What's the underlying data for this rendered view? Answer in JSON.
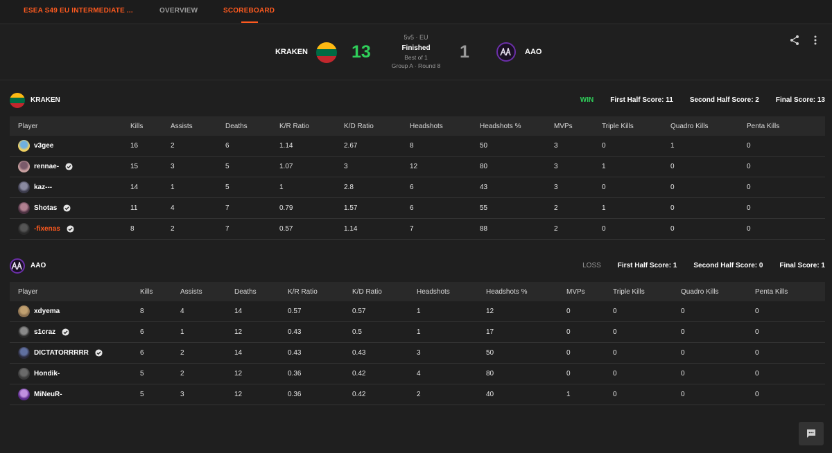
{
  "nav": {
    "event": "ESEA S49 EU INTERMEDIATE ...",
    "overview": "OVERVIEW",
    "scoreboard": "SCOREBOARD"
  },
  "match": {
    "team1": "KRAKEN",
    "team2": "AAO",
    "score1": "13",
    "score2": "1",
    "mode": "5v5 · EU",
    "status": "Finished",
    "format": "Best of 1",
    "round": "Group A · Round 8",
    "colors": {
      "win": "#2fcf5a",
      "accent": "#ff5a1f",
      "loss": "#9a9a9a"
    }
  },
  "columns": [
    "Player",
    "Kills",
    "Assists",
    "Deaths",
    "K/R Ratio",
    "K/D Ratio",
    "Headshots",
    "Headshots %",
    "MVPs",
    "Triple Kills",
    "Quadro Kills",
    "Penta Kills"
  ],
  "team1": {
    "name": "KRAKEN",
    "result": "WIN",
    "first_half": "First Half Score: 11",
    "second_half": "Second Half Score: 2",
    "final": "Final Score: 13",
    "players": [
      {
        "name": "v3gee",
        "verified": false,
        "highlight": false,
        "stats": [
          "16",
          "2",
          "6",
          "1.14",
          "2.67",
          "8",
          "50",
          "3",
          "0",
          "1",
          "0"
        ]
      },
      {
        "name": "rennae-",
        "verified": true,
        "highlight": false,
        "stats": [
          "15",
          "3",
          "5",
          "1.07",
          "3",
          "12",
          "80",
          "3",
          "1",
          "0",
          "0"
        ]
      },
      {
        "name": "kaz---",
        "verified": false,
        "highlight": false,
        "stats": [
          "14",
          "1",
          "5",
          "1",
          "2.8",
          "6",
          "43",
          "3",
          "0",
          "0",
          "0"
        ]
      },
      {
        "name": "Shotas",
        "verified": true,
        "highlight": false,
        "stats": [
          "11",
          "4",
          "7",
          "0.79",
          "1.57",
          "6",
          "55",
          "2",
          "1",
          "0",
          "0"
        ]
      },
      {
        "name": "-fixenas",
        "verified": true,
        "highlight": true,
        "stats": [
          "8",
          "2",
          "7",
          "0.57",
          "1.14",
          "7",
          "88",
          "2",
          "0",
          "0",
          "0"
        ]
      }
    ]
  },
  "team2": {
    "name": "AAO",
    "result": "LOSS",
    "first_half": "First Half Score: 1",
    "second_half": "Second Half Score: 0",
    "final": "Final Score: 1",
    "players": [
      {
        "name": "xdyema",
        "verified": false,
        "highlight": false,
        "stats": [
          "8",
          "4",
          "14",
          "0.57",
          "0.57",
          "1",
          "12",
          "0",
          "0",
          "0",
          "0"
        ]
      },
      {
        "name": "s1craz",
        "verified": true,
        "highlight": false,
        "stats": [
          "6",
          "1",
          "12",
          "0.43",
          "0.5",
          "1",
          "17",
          "0",
          "0",
          "0",
          "0"
        ]
      },
      {
        "name": "DICTATORRRRR",
        "verified": true,
        "highlight": false,
        "stats": [
          "6",
          "2",
          "14",
          "0.43",
          "0.43",
          "3",
          "50",
          "0",
          "0",
          "0",
          "0"
        ]
      },
      {
        "name": "Hondik-",
        "verified": false,
        "highlight": false,
        "stats": [
          "5",
          "2",
          "12",
          "0.36",
          "0.42",
          "4",
          "80",
          "0",
          "0",
          "0",
          "0"
        ]
      },
      {
        "name": "MiNeuR-",
        "verified": false,
        "highlight": false,
        "stats": [
          "5",
          "3",
          "12",
          "0.36",
          "0.42",
          "2",
          "40",
          "1",
          "0",
          "0",
          "0"
        ]
      }
    ]
  },
  "icons": {
    "share": "share-icon",
    "more": "kebab-icon",
    "chat": "chat-icon",
    "verified": "verified-icon"
  }
}
